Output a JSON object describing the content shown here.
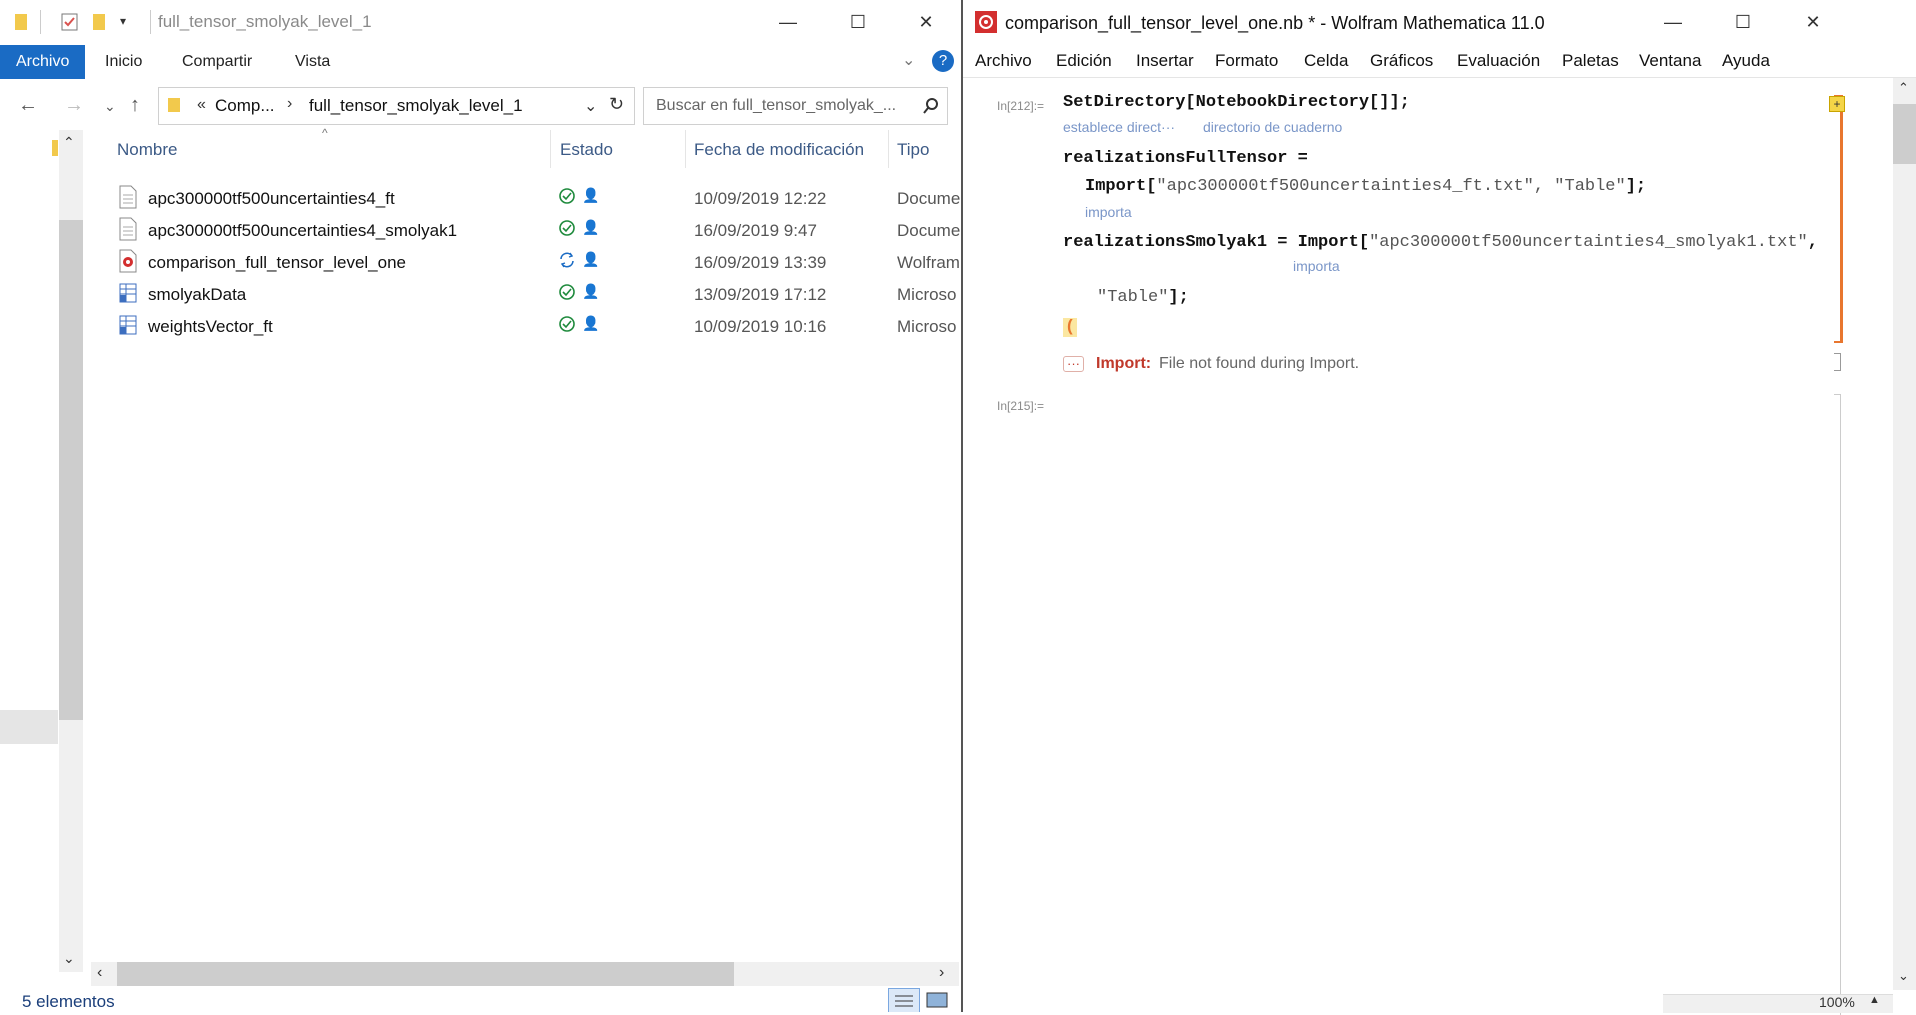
{
  "explorer": {
    "title": "full_tensor_smolyak_level_1",
    "tabs": [
      "Archivo",
      "Inicio",
      "Compartir",
      "Vista"
    ],
    "breadcrumb": [
      "Comp...",
      "full_tensor_smolyak_level_1"
    ],
    "breadcrumb_prefix": "«",
    "search_placeholder": "Buscar en full_tensor_smolyak_...",
    "columns": [
      "Nombre",
      "Estado",
      "Fecha de modificación",
      "Tipo"
    ],
    "files": [
      {
        "name": "apc300000tf500uncertainties4_ft",
        "date": "10/09/2019 12:22",
        "type": "Docume",
        "icon": "text-file-icon",
        "status": "synced-icon"
      },
      {
        "name": "apc300000tf500uncertainties4_smolyak1",
        "date": "16/09/2019 9:47",
        "type": "Docume",
        "icon": "text-file-icon",
        "status": "synced-icon"
      },
      {
        "name": "comparison_full_tensor_level_one",
        "date": "16/09/2019 13:39",
        "type": "Wolfram",
        "icon": "mathematica-file-icon",
        "status": "syncing-icon"
      },
      {
        "name": "smolyakData",
        "date": "13/09/2019 17:12",
        "type": "Microso",
        "icon": "spreadsheet-file-icon",
        "status": "synced-icon"
      },
      {
        "name": "weightsVector_ft",
        "date": "10/09/2019 10:16",
        "type": "Microso",
        "icon": "spreadsheet-file-icon",
        "status": "synced-icon"
      }
    ],
    "status_text": "5 elementos",
    "accent": "#1a6bc4"
  },
  "math": {
    "title": "comparison_full_tensor_level_one.nb * - Wolfram Mathematica 11.0",
    "menu": [
      "Archivo",
      "Edición",
      "Insertar",
      "Formato",
      "Celda",
      "Gráficos",
      "Evaluación",
      "Paletas",
      "Ventana",
      "Ayuda"
    ],
    "in_label_1": "In[212]:=",
    "in_label_2": "In[215]:=",
    "line1": "SetDirectory[NotebookDirectory[]];",
    "hint1a": "establece direct···",
    "hint1b": "directorio de cuaderno",
    "line2": "realizationsFullTensor =",
    "line3a": "Import[",
    "line3s": "\"apc300000tf500uncertainties4_ft.txt\", \"Table\"",
    "line3b": "];",
    "hint3": "importa",
    "line4a": "realizationsSmolyak1 = Import[",
    "line4s": "\"apc300000tf500uncertainties4_smolyak1.txt\"",
    "line4b": ",",
    "hint4": "importa",
    "line5s": "\"Table\"",
    "line5b": "];",
    "paren": "(",
    "msg_dots": "···",
    "msg_head": "Import:",
    "msg_text": "File not found during Import.",
    "zoom": "100%",
    "error_color": "#c0392b",
    "bracket_color": "#e8762e"
  }
}
